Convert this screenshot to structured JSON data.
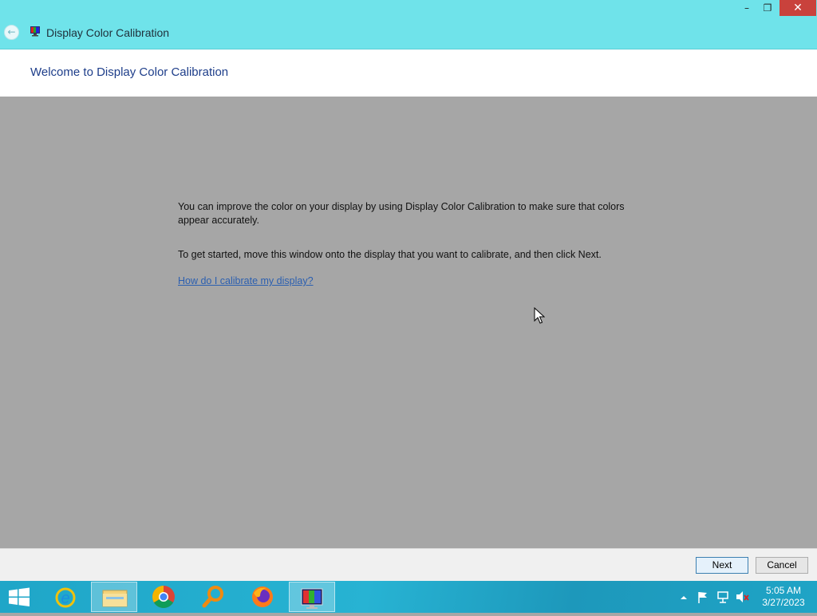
{
  "window": {
    "title": "Display Color Calibration",
    "controls": {
      "minimize": "–",
      "restore": "❐",
      "close": "✕"
    }
  },
  "header": {
    "title": "Welcome to Display Color Calibration"
  },
  "content": {
    "paragraph1": "You can improve the color on your display by using Display Color Calibration to make sure that colors appear accurately.",
    "paragraph2": "To get started, move this window onto the display that you want to calibrate, and then click Next.",
    "help_link": "How do I calibrate my display?"
  },
  "footer": {
    "next_label": "Next",
    "cancel_label": "Cancel"
  },
  "taskbar": {
    "items": [
      {
        "name": "start-button",
        "icon": "windows-logo-icon"
      },
      {
        "name": "internet-explorer",
        "icon": "internet-explorer-icon"
      },
      {
        "name": "file-explorer",
        "icon": "folder-icon"
      },
      {
        "name": "chrome",
        "icon": "chrome-icon"
      },
      {
        "name": "search-tool",
        "icon": "magnifier-icon"
      },
      {
        "name": "firefox",
        "icon": "firefox-icon"
      },
      {
        "name": "display-color-calibration",
        "icon": "display-calibration-icon",
        "active": true
      }
    ],
    "clock": {
      "time": "5:05 AM",
      "date": "3/27/2023"
    }
  },
  "colors": {
    "titlebar": "#6fe3ea",
    "heading": "#1e3e8a",
    "content_bg": "#a6a6a6",
    "link": "#2b5fb0",
    "taskbar": "#1fa4c6",
    "close_button": "#c9423c"
  }
}
